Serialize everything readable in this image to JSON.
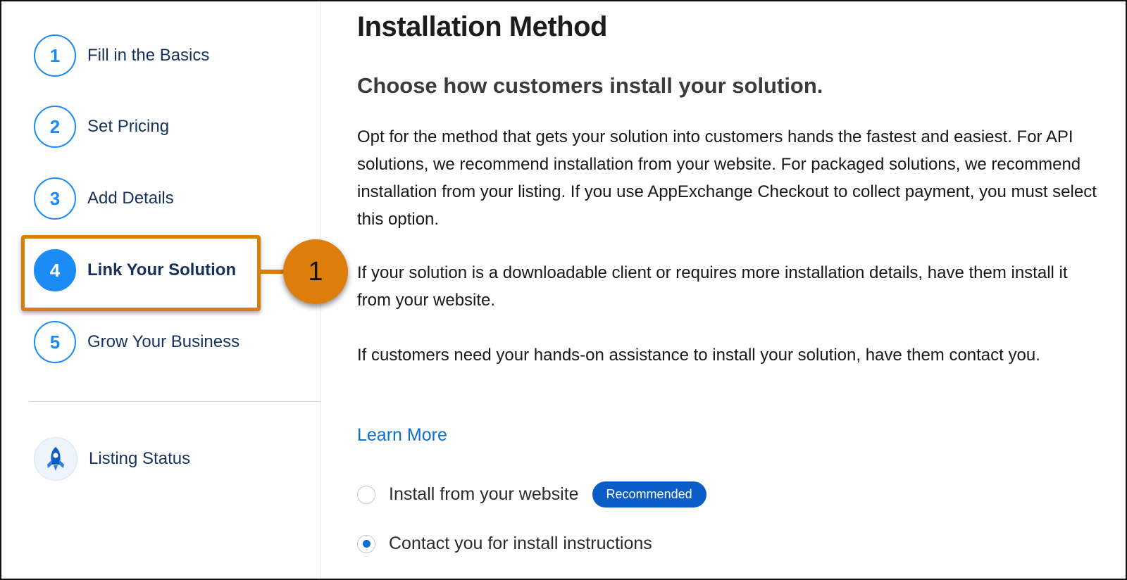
{
  "sidebar": {
    "steps": [
      {
        "number": "1",
        "label": "Fill in the Basics"
      },
      {
        "number": "2",
        "label": "Set Pricing"
      },
      {
        "number": "3",
        "label": "Add Details"
      },
      {
        "number": "4",
        "label": "Link Your Solution",
        "active": true
      },
      {
        "number": "5",
        "label": "Grow Your Business"
      }
    ],
    "listing_status": {
      "label": "Listing Status",
      "icon": "rocket-icon"
    }
  },
  "callout": {
    "number": "1",
    "color": "#dd7d0b"
  },
  "main": {
    "title": "Installation Method",
    "subtitle": "Choose how customers install your solution.",
    "paragraphs": [
      "Opt for the method that gets your solution into customers hands the fastest and easiest. For API solutions, we recommend installation from your website. For packaged solutions, we recommend installation from your listing. If you use AppExchange Checkout to collect payment, you must select this option.",
      "If your solution is a downloadable client or requires more installation details, have them install it from your website.",
      "If customers need your hands-on assistance to install your solution, have them contact you."
    ],
    "learn_more": "Learn More",
    "options": [
      {
        "label": "Install from your website",
        "badge": "Recommended",
        "selected": false
      },
      {
        "label": "Contact you for install instructions",
        "selected": true
      }
    ]
  },
  "colors": {
    "accent": "#1b8bf5",
    "link": "#0b6fcf",
    "highlight": "#d97d0b"
  }
}
